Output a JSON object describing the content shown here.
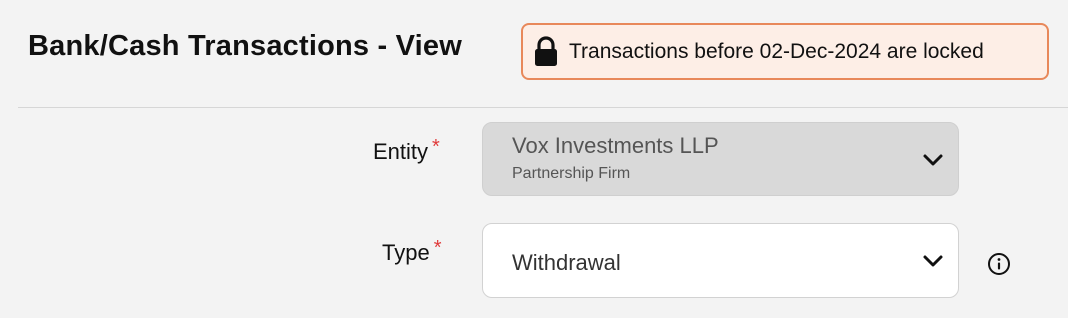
{
  "header": {
    "title": "Bank/Cash Transactions - View",
    "lock_banner": {
      "icon": "lock-icon",
      "text": "Transactions before 02-Dec-2024 are locked",
      "border_color": "#e8885a",
      "background_color": "#fdeee6"
    }
  },
  "form": {
    "entity": {
      "label": "Entity",
      "required_marker": "*",
      "selected_name": "Vox Investments LLP",
      "selected_subtitle": "Partnership Firm",
      "icon": "chevron-down-icon",
      "disabled": true
    },
    "type": {
      "label": "Type",
      "required_marker": "*",
      "selected_value": "Withdrawal",
      "icon": "chevron-down-icon",
      "info_icon": "info-icon"
    }
  },
  "colors": {
    "required": "#e03a3a",
    "page_background": "#f3f3f3",
    "disabled_field": "#d9d9d9"
  }
}
